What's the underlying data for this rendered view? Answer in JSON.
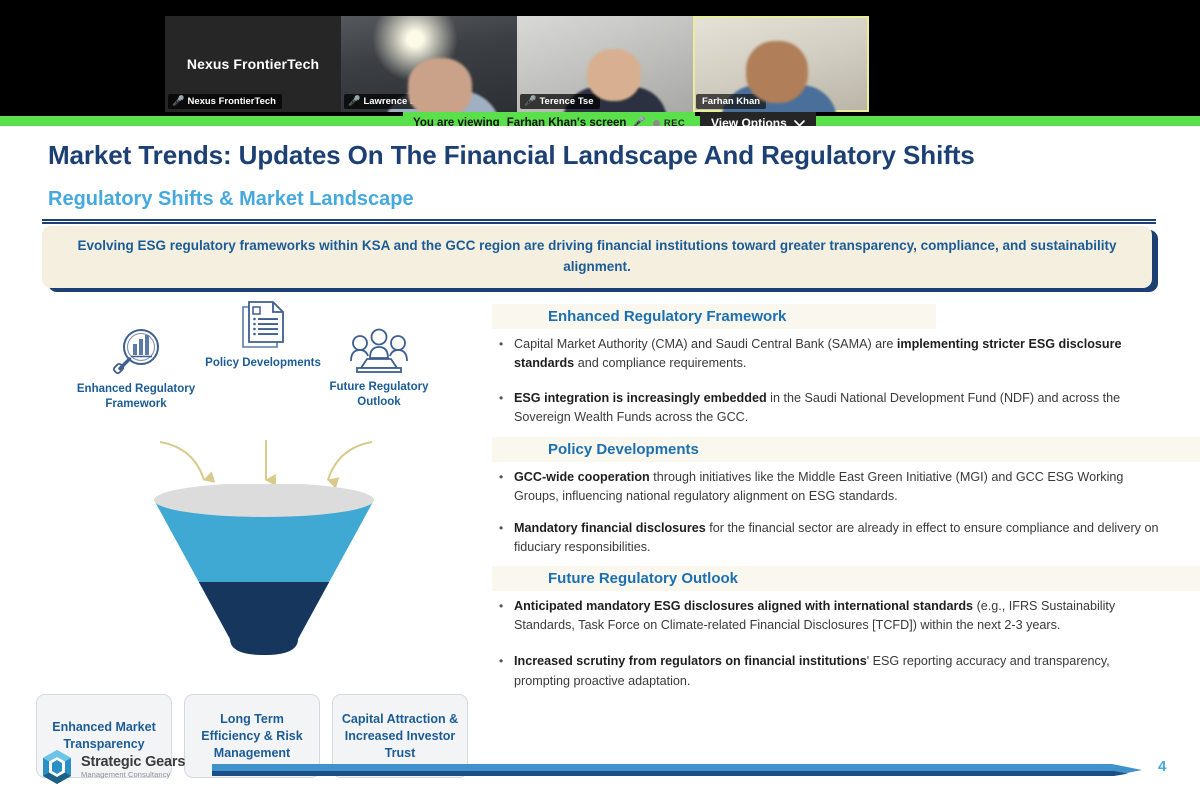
{
  "meeting": {
    "status_text": "You are viewing",
    "sharer_text": "Farhan Khan's screen",
    "rec_label": "REC",
    "view_options_label": "View Options",
    "chevron_icon": "chevron-down-icon",
    "mic_icon": "mic-muted-icon",
    "participants": [
      {
        "name": "Nexus FrontierTech",
        "display_name": "Nexus FrontierTech",
        "muted": true,
        "active": false
      },
      {
        "name": "Lawrence Billson",
        "muted": true,
        "active": false
      },
      {
        "name": "Terence Tse",
        "muted": true,
        "active": false
      },
      {
        "name": "Farhan Khan",
        "muted": false,
        "active": true
      }
    ]
  },
  "slide": {
    "title": "Market Trends: Updates On The Financial Landscape And Regulatory Shifts",
    "subtitle": "Regulatory Shifts & Market Landscape",
    "callout": "Evolving ESG regulatory frameworks within KSA and the GCC region are driving financial institutions toward greater transparency, compliance, and sustainability alignment.",
    "page_number": "4",
    "logo": {
      "name": "Strategic Gears",
      "tagline": "Management Consultancy",
      "mark": "hexagon-gear-icon"
    },
    "funnel": {
      "inputs": [
        {
          "label": "Enhanced Regulatory Framework",
          "icon": "magnifier-bar-chart-icon"
        },
        {
          "label": "Policy Developments",
          "icon": "documents-icon"
        },
        {
          "label": "Future Regulatory Outlook",
          "icon": "people-meeting-icon"
        }
      ],
      "outcomes": [
        "Enhanced Market Transparency",
        "Long Term Efficiency & Risk Management",
        "Capital Attraction & Increased Investor Trust"
      ]
    },
    "sections": [
      {
        "heading": "Enhanced Regulatory Framework",
        "bullets": [
          [
            {
              "t": "Capital Market Authority (CMA) and Saudi Central Bank (SAMA) are ",
              "b": false
            },
            {
              "t": "implementing stricter ESG disclosure standards",
              "b": true
            },
            {
              "t": " and compliance requirements.",
              "b": false
            }
          ],
          [
            {
              "t": "ESG integration is increasingly embedded",
              "b": true
            },
            {
              "t": " in the Saudi National Development Fund (NDF) and across the Sovereign Wealth Funds across the GCC.",
              "b": false
            }
          ]
        ]
      },
      {
        "heading": "Policy Developments",
        "bullets": [
          [
            {
              "t": "GCC-wide cooperation",
              "b": true
            },
            {
              "t": " through initiatives like the Middle East Green Initiative (MGI) and GCC ESG Working Groups, influencing national regulatory alignment on ESG standards.",
              "b": false
            }
          ],
          [
            {
              "t": "Mandatory financial disclosures",
              "b": true
            },
            {
              "t": " for the financial sector are already in effect to ensure compliance and delivery on fiduciary responsibilities.",
              "b": false
            }
          ]
        ]
      },
      {
        "heading": "Future Regulatory Outlook",
        "bullets": [
          [
            {
              "t": "Anticipated mandatory ESG disclosures aligned with international standards",
              "b": true
            },
            {
              "t": " (e.g., IFRS Sustainability Standards, Task Force on Climate-related Financial Disclosures [TCFD]) within the next 2-3 years.",
              "b": false
            }
          ],
          [
            {
              "t": "Increased scrutiny from regulators on financial institutions",
              "b": true
            },
            {
              "t": "' ESG reporting accuracy and transparency, prompting proactive adaptation.",
              "b": false
            }
          ]
        ]
      }
    ]
  },
  "colors": {
    "navy": "#1c3f74",
    "light_blue": "#45a9dd",
    "section_blue": "#1c6fb0",
    "cream": "#f4efdf",
    "funnel_light": "#3fa9d4",
    "funnel_dark": "#16365e",
    "zoom_green": "#5ae04a"
  }
}
